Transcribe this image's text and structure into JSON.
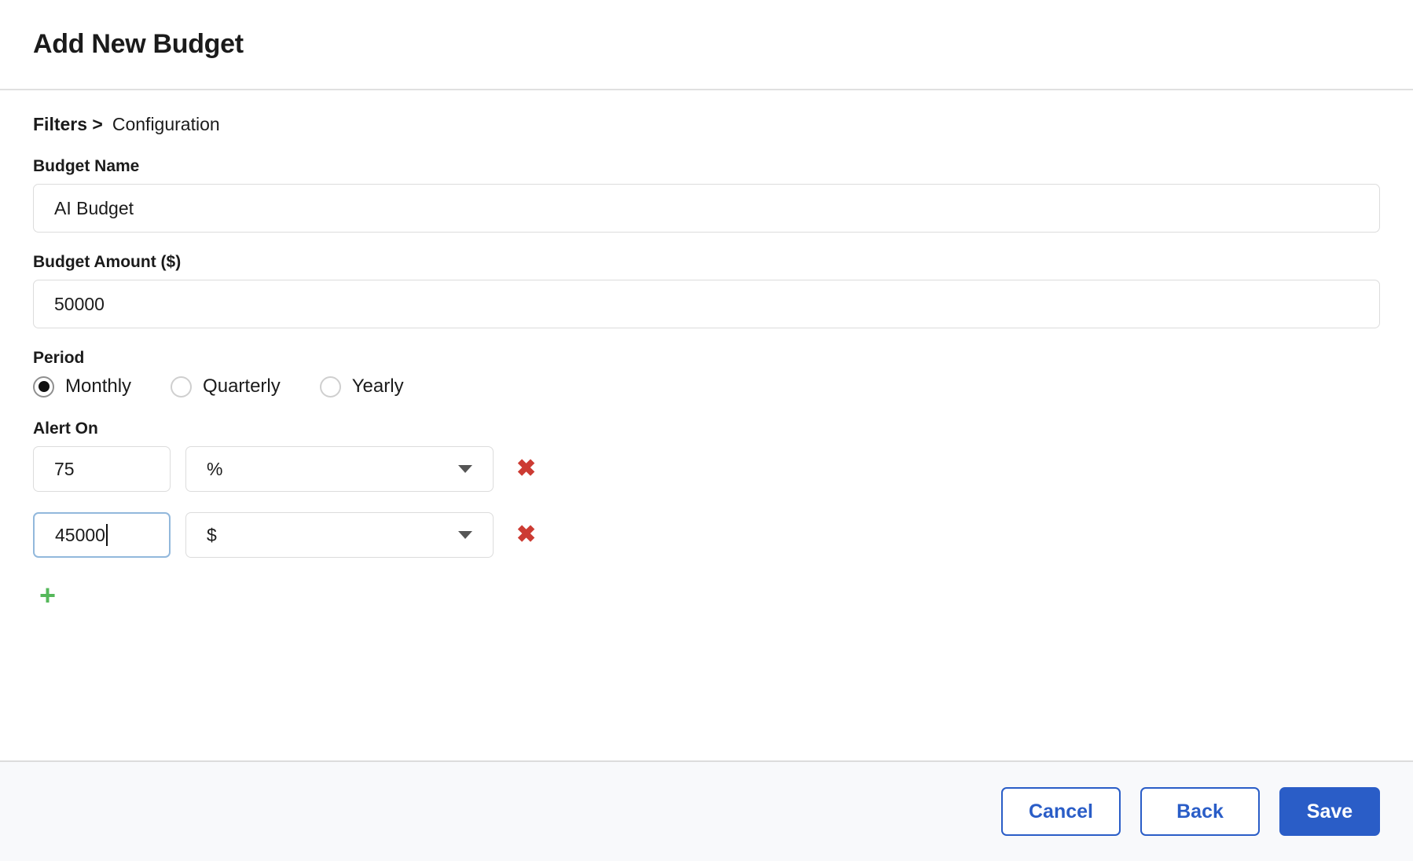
{
  "header": {
    "title": "Add New Budget"
  },
  "breadcrumb": {
    "step": "Filters >",
    "current": "Configuration"
  },
  "form": {
    "budget_name": {
      "label": "Budget Name",
      "value": "AI Budget",
      "placeholder": "Budget Name"
    },
    "budget_amount": {
      "label": "Budget Amount ($)",
      "value": "50000",
      "placeholder": "Budget Amount"
    },
    "period": {
      "label": "Period",
      "selected": "Monthly",
      "options": [
        "Monthly",
        "Quarterly",
        "Yearly"
      ]
    },
    "alert_on": {
      "label": "Alert On",
      "add_label": "+",
      "remove_label": "✖",
      "unit_options": [
        "%",
        "$"
      ],
      "rows": [
        {
          "value": "75",
          "unit": "%",
          "focused": false
        },
        {
          "value": "45000",
          "unit": "$",
          "focused": true
        }
      ]
    }
  },
  "footer": {
    "cancel_label": "Cancel",
    "back_label": "Back",
    "save_label": "Save"
  },
  "colors": {
    "primary": "#2a5dc7",
    "danger": "#cc3b33",
    "success": "#55b85a",
    "border": "#dcdcdc",
    "focus_border": "#92b8dc",
    "footer_bg": "#f8f9fb"
  }
}
